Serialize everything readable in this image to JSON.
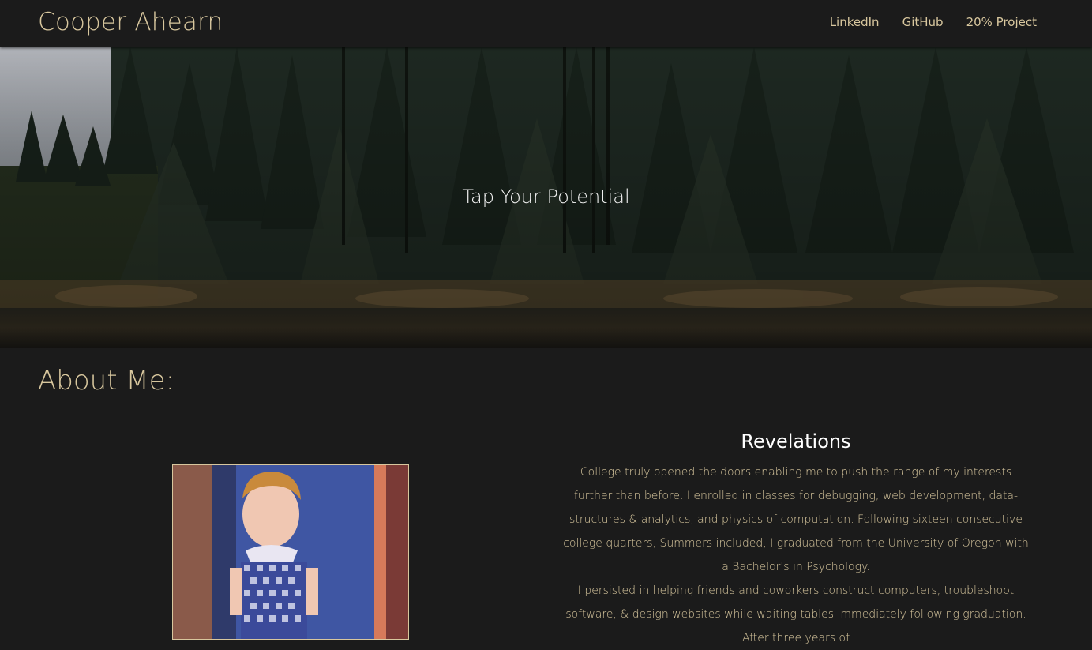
{
  "navbar": {
    "brand": "Cooper Ahearn",
    "links": [
      {
        "label": "LinkedIn"
      },
      {
        "label": "GitHub"
      },
      {
        "label": "20% Project"
      }
    ]
  },
  "hero": {
    "title": "Tap Your Potential"
  },
  "about": {
    "heading": "About Me:",
    "section_title": "Revelations",
    "paragraphs": [
      "College truly opened the doors enabling me to push the range of my interests further than before. I enrolled in classes for debugging, web development, data-structures & analytics, and physics of computation. Following sixteen consecutive college quarters, Summers included, I graduated from the University of Oregon with a Bachelor's in Psychology.",
      "I persisted in helping friends and coworkers construct computers, troubleshoot software, & design websites while waiting tables immediately following graduation. After three years of"
    ]
  },
  "colors": {
    "background": "#1b1b1b",
    "accent": "#d8c79e",
    "hero_text": "#f2f2f2"
  }
}
